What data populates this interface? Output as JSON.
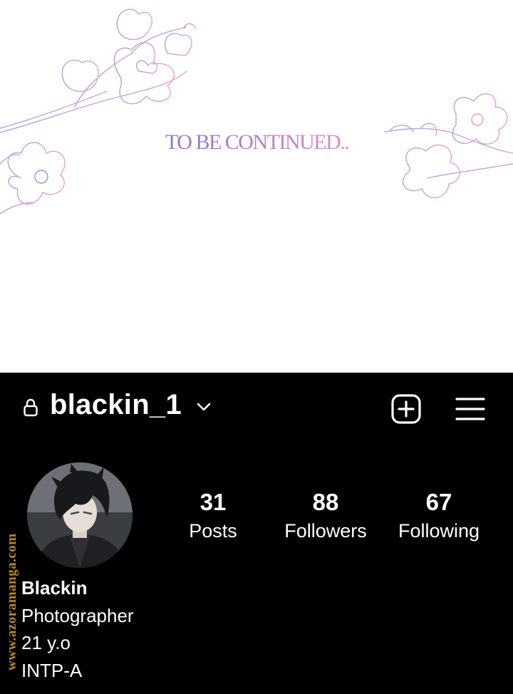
{
  "banner": {
    "caption": "TO BE CONTINUED.."
  },
  "profile": {
    "username": "blackin_1",
    "icons": {
      "lock": "lock-icon",
      "chevron": "chevron-down-icon",
      "create": "plus-square-icon",
      "menu": "hamburger-menu-icon"
    },
    "stats": [
      {
        "value": "31",
        "label": "Posts"
      },
      {
        "value": "88",
        "label": "Followers"
      },
      {
        "value": "67",
        "label": "Following"
      }
    ],
    "bio": {
      "name": "Blackin",
      "line1": "Photographer",
      "line2": "21 y.o",
      "line3": "INTP-A"
    }
  },
  "watermark": "www.azoramanga.com",
  "colors": {
    "panel_bg": "#000000",
    "text": "#ffffff",
    "caption_gradient": [
      "#8a7ad0",
      "#e08dc2"
    ],
    "watermark": "#b98a1e"
  }
}
